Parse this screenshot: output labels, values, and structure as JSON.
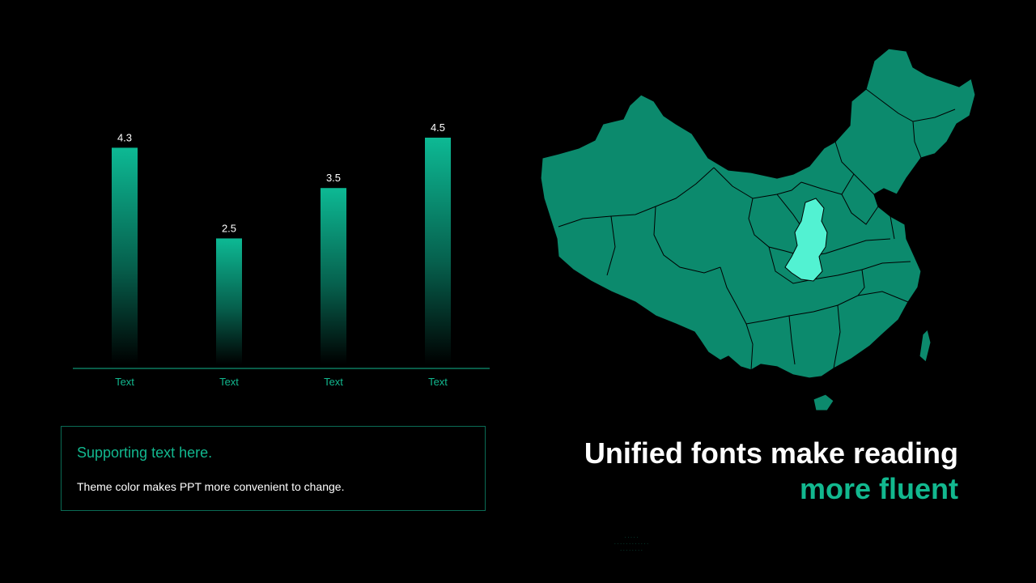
{
  "colors": {
    "accent": "#12b88f",
    "bar_top": "#0db994",
    "map_fill": "#0c8a6d",
    "map_highlight": "#52f2d2",
    "border": "#0a6b55"
  },
  "chart_data": {
    "type": "bar",
    "categories": [
      "Text",
      "Text",
      "Text",
      "Text"
    ],
    "values": [
      4.3,
      2.5,
      3.5,
      4.5
    ],
    "title": "",
    "xlabel": "",
    "ylabel": "",
    "ylim": [
      0,
      4.5
    ],
    "grid": false,
    "data_labels": [
      "4.3",
      "2.5",
      "3.5",
      "4.5"
    ]
  },
  "card": {
    "title": "Supporting text here.",
    "body": "Theme color makes PPT more convenient to change."
  },
  "headline": {
    "line1": "Unified fonts make reading",
    "line2": "more fluent"
  },
  "map": {
    "icon": "china-map-icon",
    "highlighted_region": "shaanxi"
  }
}
